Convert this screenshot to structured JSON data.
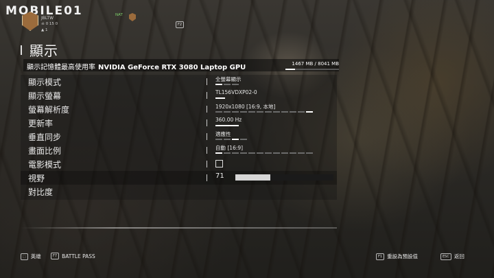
{
  "watermark": {
    "logo_text": "MOBILE01"
  },
  "profile": {
    "name": "JBLTW",
    "stats_line": "0  15  0",
    "level": "1",
    "nat_label": "NAT",
    "social_key": "F2"
  },
  "page": {
    "title": "顯示"
  },
  "header": {
    "vram_label": "顯示記憶體最高使用率",
    "gpu_name": "NVIDIA GeForce RTX 3080 Laptop GPU",
    "vram_usage": "1467 MB / 8041 MB",
    "vram_fraction": 0.18
  },
  "settings": [
    {
      "label": "顯示模式",
      "value": "全螢幕顯示",
      "segments": 3,
      "selected": 1
    },
    {
      "label": "顯示螢幕",
      "value": "TL156VDXP02-0",
      "segments": 1,
      "selected": 1
    },
    {
      "label": "螢幕解析度",
      "value": "1920x1080 [16:9, 本地]",
      "segments": 12,
      "selected": 12
    },
    {
      "label": "更新率",
      "value": "360.00 Hz",
      "segments": 1,
      "selected": 1
    },
    {
      "label": "垂直同步",
      "value": "適應性",
      "segments": 4,
      "selected": 3
    },
    {
      "label": "畫面比例",
      "value": "自動 [16:9]",
      "segments": 12,
      "selected": 1
    },
    {
      "label": "電影模式",
      "value": "",
      "checkbox": true,
      "checked": false
    },
    {
      "label": "視野",
      "value": "71",
      "slider_fraction": 0.36
    },
    {
      "label": "對比度",
      "value": ""
    }
  ],
  "footer": {
    "hero_key": "⬚",
    "hero_label": "英雄",
    "battlepass_key": "F7",
    "battlepass_label": "BATTLE PASS",
    "reset_key": "F1",
    "reset_label": "重設為預設值",
    "back_key": "ESC",
    "back_label": "返回"
  }
}
